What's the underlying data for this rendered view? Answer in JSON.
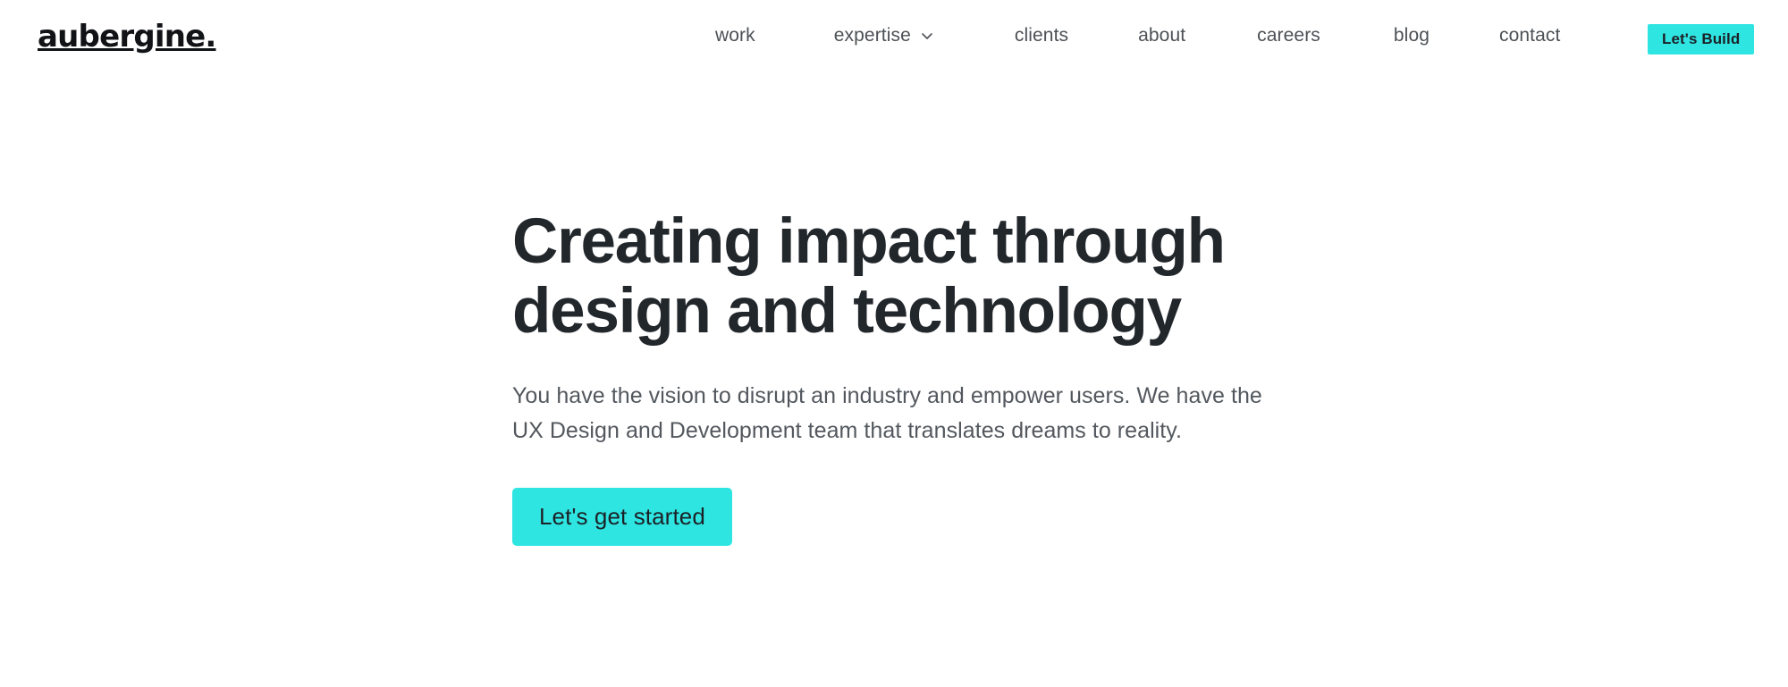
{
  "header": {
    "brand": "aubergine.",
    "nav_items": [
      {
        "label": "work",
        "has_dropdown": false
      },
      {
        "label": "expertise",
        "has_dropdown": true,
        "icon": "chevron-down-icon"
      },
      {
        "label": "clients",
        "has_dropdown": false
      },
      {
        "label": "about",
        "has_dropdown": false
      },
      {
        "label": "careers",
        "has_dropdown": false
      },
      {
        "label": "blog",
        "has_dropdown": false
      },
      {
        "label": "contact",
        "has_dropdown": false
      }
    ],
    "cta_label": "Let's Build"
  },
  "hero": {
    "title": "Creating impact through design and technology",
    "subtitle": "You have the vision to disrupt an industry and empower users. We have the UX Design and Development team that translates dreams to reality.",
    "cta_label": "Let's get started"
  },
  "colors": {
    "accent": "#2EE5E2",
    "heading_text": "#22272C",
    "body_text": "#53585E",
    "nav_text": "#4C5156",
    "brand_text": "#111316",
    "accent_text": "#1C2126",
    "page_background": "#FFFFFF"
  }
}
